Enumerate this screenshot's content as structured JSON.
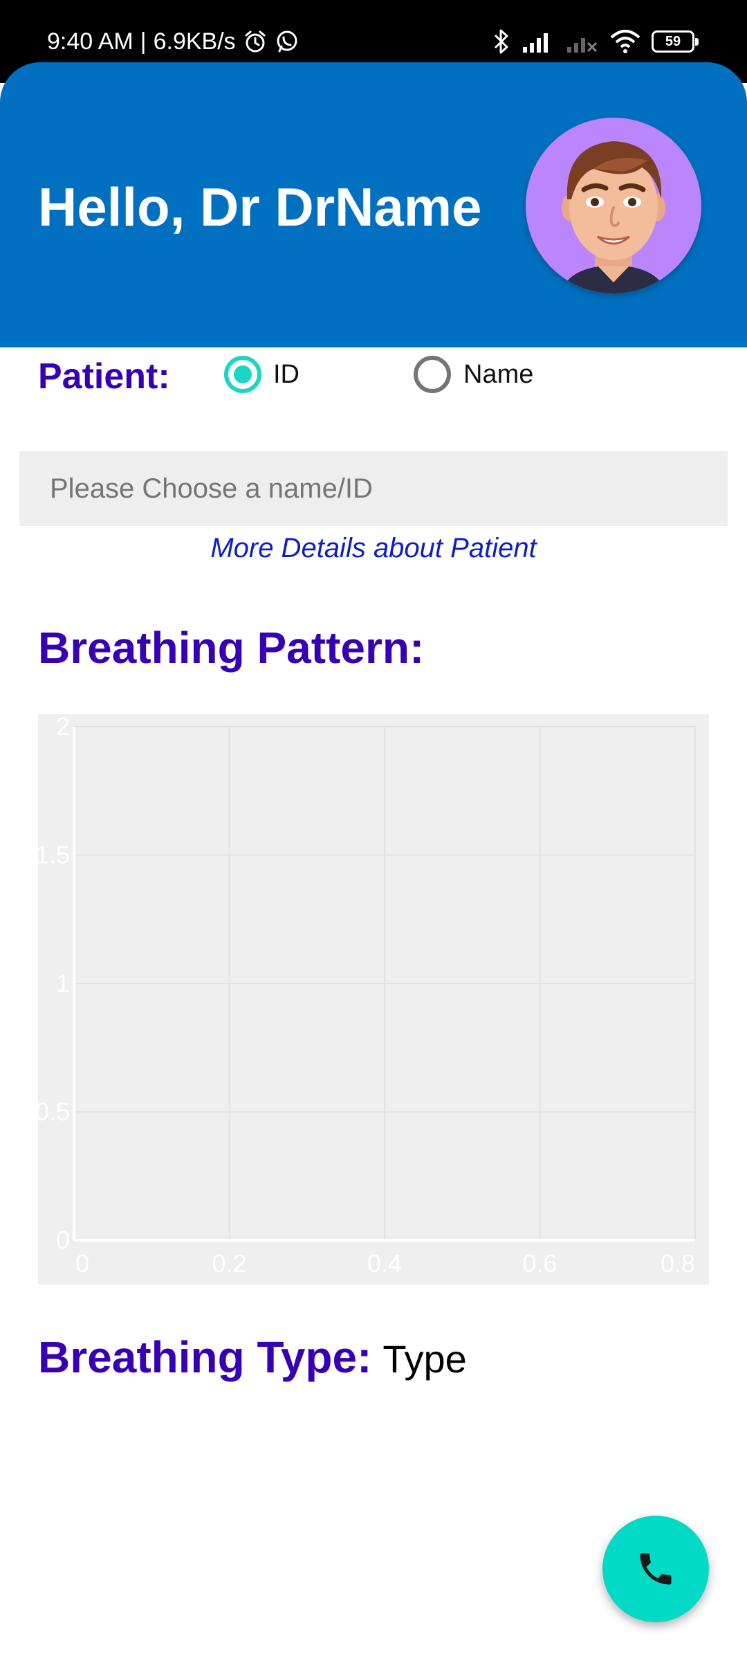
{
  "status_bar": {
    "time": "9:40 AM",
    "separator": "|",
    "speed": "6.9KB/s",
    "battery": "59",
    "icons": [
      "alarm-icon",
      "whatsapp-icon",
      "bluetooth-icon",
      "signal-icon",
      "signal-off-icon",
      "wifi-icon",
      "battery-icon"
    ]
  },
  "header": {
    "greeting": "Hello, Dr DrName",
    "avatar": "doctor-avatar",
    "color": "#0270c1"
  },
  "patient": {
    "label": "Patient:",
    "options": [
      {
        "label": "ID",
        "selected": true
      },
      {
        "label": "Name",
        "selected": false
      }
    ],
    "search_placeholder": "Please Choose a name/ID",
    "search_value": "",
    "details_link": "More Details about Patient"
  },
  "breathing": {
    "pattern_title": "Breathing Pattern:",
    "type_label": "Breathing Type:",
    "type_value": "Type"
  },
  "chart_data": {
    "type": "line",
    "series": [],
    "x_ticks": [
      "0",
      "0.2",
      "0.4",
      "0.6",
      "0.8"
    ],
    "y_ticks": [
      "0",
      "0.5",
      "1",
      "1.5",
      "2"
    ],
    "xlim": [
      0,
      0.8
    ],
    "ylim": [
      0,
      2
    ],
    "grid": true,
    "background": "#efefef"
  },
  "fab": {
    "icon": "phone-icon",
    "color": "#03dac5"
  },
  "colors": {
    "accent": "#3700b3",
    "teal": "#03dac5",
    "link": "#0d1ec5"
  }
}
